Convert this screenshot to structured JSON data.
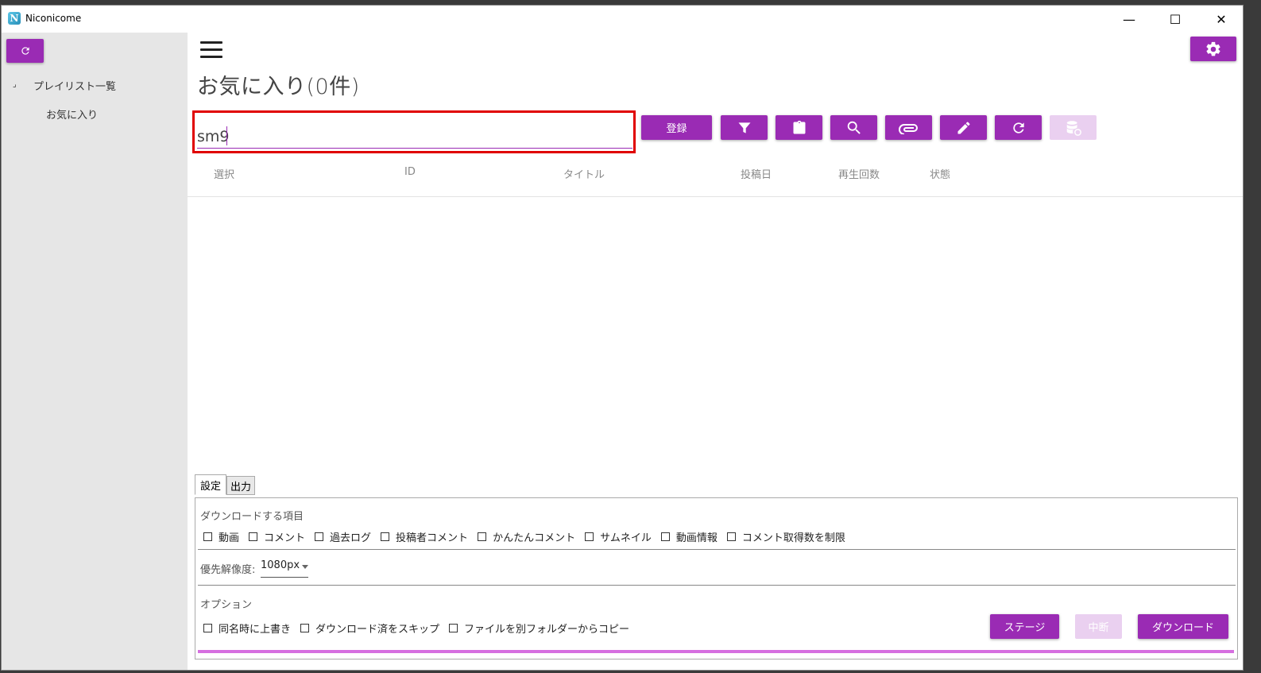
{
  "window": {
    "title": "Niconicome",
    "icon_letter": "N",
    "controls": {
      "minimize": "—",
      "maximize": "☐",
      "close": "✕"
    }
  },
  "sidebar": {
    "refresh_icon": "refresh-icon",
    "tree_toggle": "⌟",
    "tree": {
      "root": "プレイリスト一覧",
      "children": [
        "お気に入り"
      ]
    }
  },
  "main": {
    "page_title": "お気に入り(0件)",
    "settings_icon": "gear-icon",
    "search": {
      "value": "sm9"
    },
    "toolbar": {
      "register_label": "登録",
      "icons": [
        "filter-icon",
        "clipboard-icon",
        "search-icon",
        "paperclip-icon",
        "pencil-icon",
        "refresh-icon",
        "database-sync-icon"
      ]
    },
    "table": {
      "columns": [
        "選択",
        "ID",
        "タイトル",
        "投稿日",
        "再生回数",
        "状態"
      ],
      "rows": []
    }
  },
  "bottom": {
    "tabs": [
      "設定",
      "出力"
    ],
    "active_tab": "設定",
    "download_items_label": "ダウンロードする項目",
    "download_items": [
      "動画",
      "コメント",
      "過去ログ",
      "投稿者コメント",
      "かんたんコメント",
      "サムネイル",
      "動画情報",
      "コメント取得数を制限"
    ],
    "resolution_label": "優先解像度:",
    "resolution_value": "1080px",
    "options_label": "オプション",
    "options": [
      "同名時に上書き",
      "ダウンロード済をスキップ",
      "ファイルを別フォルダーからコピー"
    ],
    "buttons": {
      "stage": "ステージ",
      "abort": "中断",
      "download": "ダウンロード"
    }
  },
  "colors": {
    "accent": "#9a2bb4",
    "accent_disabled": "#ead0f0",
    "highlight": "#e00000",
    "sidebar_bg": "#e6e6e6"
  }
}
